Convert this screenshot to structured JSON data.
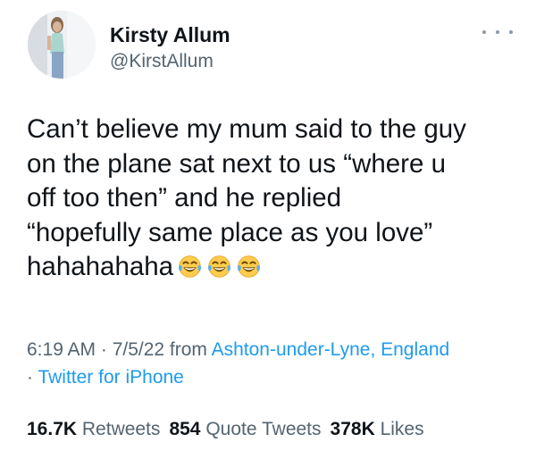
{
  "author": {
    "name": "Kirsty Allum",
    "handle": "@KirstAllum"
  },
  "tweet": {
    "lines": [
      "Can’t believe my mum said to the guy",
      "on the plane sat next to us “where u",
      "off too then” and he replied",
      "“hopefully same place as you love”",
      "hahahahaha"
    ],
    "emoji_name": "face-with-tears-of-joy-icon",
    "emoji_count": 3
  },
  "meta": {
    "time_date": "6:19 AM · 7/5/22 from ",
    "location": "Ashton-under-Lyne, England",
    "separator": "· ",
    "source": "Twitter for iPhone"
  },
  "stats": {
    "retweets_count": "16.7K",
    "retweets_label": "Retweets",
    "quotes_count": "854",
    "quotes_label": "Quote Tweets",
    "likes_count": "378K",
    "likes_label": "Likes"
  },
  "colors": {
    "link": "#1d9bf0",
    "secondary_text": "#536471",
    "primary_text": "#0f1419",
    "background": "#ffffff"
  }
}
